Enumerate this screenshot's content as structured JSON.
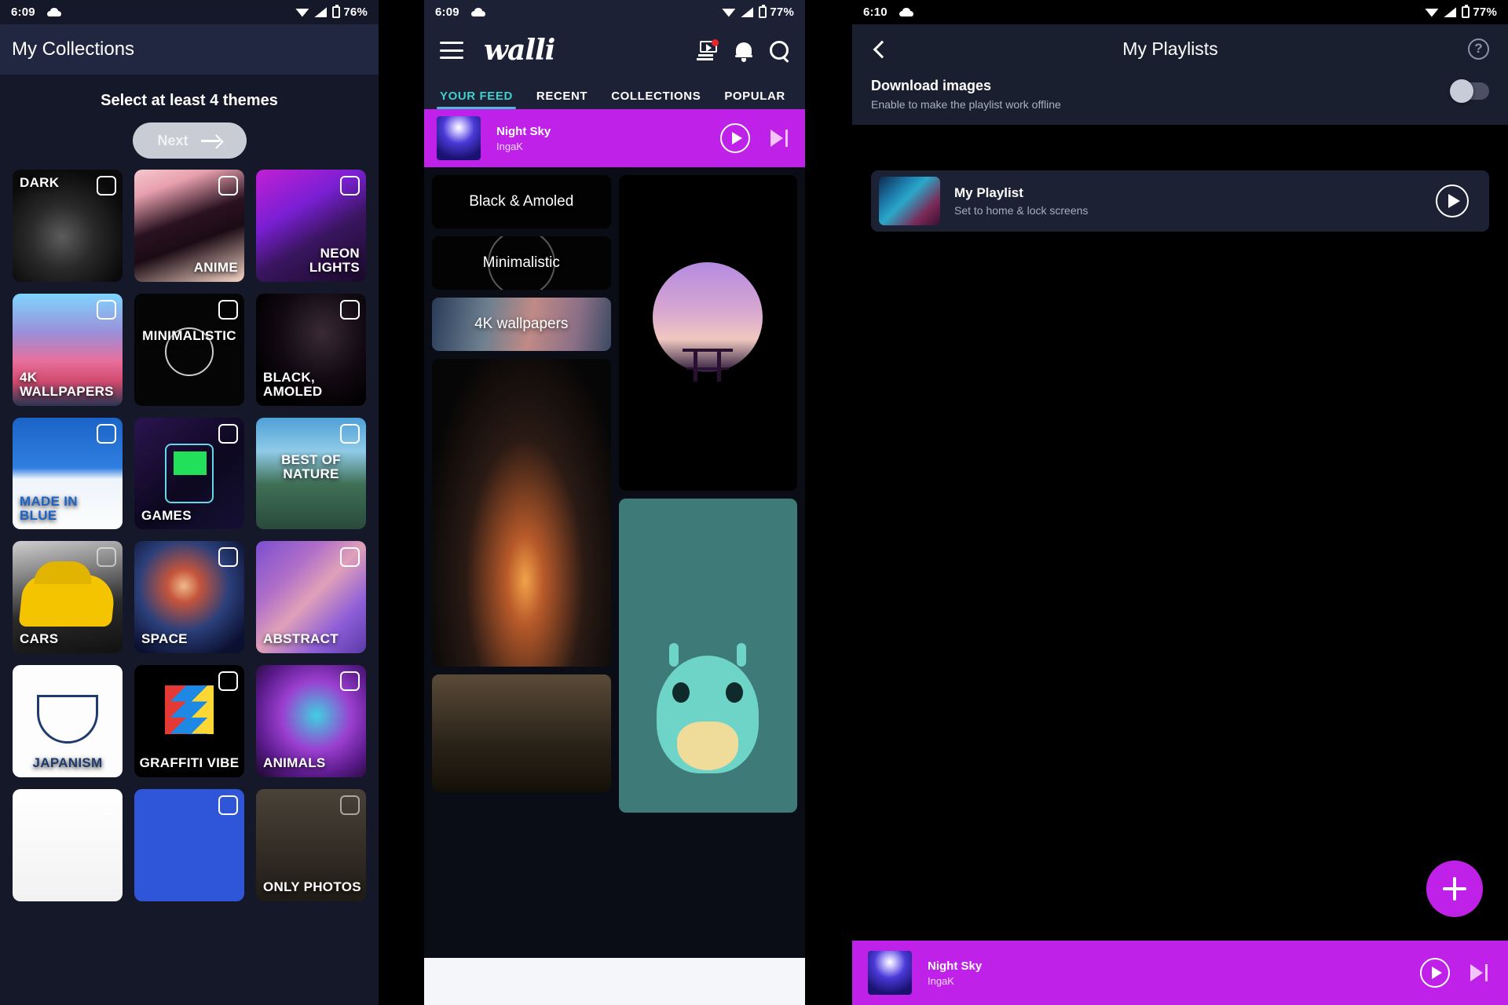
{
  "panel1": {
    "status": {
      "time": "6:09",
      "battery": "76%",
      "icons": [
        "cloud-icon",
        "wifi-icon",
        "signal-icon",
        "battery-icon"
      ]
    },
    "appbar": {
      "title": "My Collections"
    },
    "subtitle": "Select at least 4 themes",
    "next_button": {
      "label": "Next",
      "icon": "arrow-right-icon"
    },
    "tiles": [
      {
        "label": "DARK",
        "pos": "tl",
        "art": "a-dark",
        "checked": false
      },
      {
        "label": "ANIME",
        "pos": "br",
        "art": "a-anime",
        "checked": false
      },
      {
        "label": "NEON\nLIGHTS",
        "pos": "br",
        "art": "a-neon",
        "checked": false
      },
      {
        "label": "4K\nWALLPAPERS",
        "pos": "bl",
        "art": "a-4k",
        "checked": false
      },
      {
        "label": "MINIMALISTIC",
        "pos": "cc",
        "art": "a-min",
        "checked": false
      },
      {
        "label": "BLACK,\nAMOLED",
        "pos": "bl",
        "art": "a-black",
        "checked": false
      },
      {
        "label": "MADE IN\nBLUE",
        "pos": "bl",
        "art": "a-blue",
        "checked": false
      },
      {
        "label": "GAMES",
        "pos": "bl",
        "art": "a-games",
        "checked": false
      },
      {
        "label": "BEST OF NATURE",
        "pos": "cc",
        "art": "a-nature",
        "checked": false
      },
      {
        "label": "CARS",
        "pos": "bl",
        "art": "a-cars",
        "checked": false
      },
      {
        "label": "SPACE",
        "pos": "bl",
        "art": "a-space",
        "checked": false
      },
      {
        "label": "ABSTRACT",
        "pos": "bl",
        "art": "a-abs",
        "checked": false
      },
      {
        "label": "JAPANISM",
        "pos": "bc",
        "art": "a-jap",
        "checked": false
      },
      {
        "label": "GRAFFITI VIBE",
        "pos": "bc",
        "art": "a-graf",
        "checked": false
      },
      {
        "label": "ANIMALS",
        "pos": "bl",
        "art": "a-ani",
        "checked": false
      },
      {
        "label": "",
        "pos": "bl",
        "art": "a-w1",
        "checked": false
      },
      {
        "label": "",
        "pos": "bl",
        "art": "a-w2",
        "checked": false
      },
      {
        "label": "ONLY PHOTOS",
        "pos": "bl",
        "art": "a-w3",
        "checked": false
      }
    ]
  },
  "panel2": {
    "status": {
      "time": "6:09",
      "battery": "77%"
    },
    "brand": "walli",
    "icons": {
      "menu": "hamburger-menu-icon",
      "stack": "video-stack-icon",
      "bell": "notifications-icon",
      "search": "search-icon"
    },
    "tabs": [
      {
        "label": "YOUR FEED",
        "active": true
      },
      {
        "label": "RECENT",
        "active": false
      },
      {
        "label": "COLLECTIONS",
        "active": false
      },
      {
        "label": "POPULAR",
        "active": false
      }
    ],
    "player": {
      "title": "Night Sky",
      "artist": "IngaK",
      "play_icon": "play-circle-icon",
      "next_icon": "skip-next-icon"
    },
    "chips": [
      {
        "label": "Black & Amoled",
        "art": "c-black"
      },
      {
        "label": "Minimalistic",
        "art": "c-min"
      },
      {
        "label": "4K wallpapers",
        "art": "c-4k"
      }
    ],
    "accent": "#3fd0c9",
    "player_color": "#c021e8"
  },
  "panel3": {
    "status": {
      "time": "6:10",
      "battery": "77%"
    },
    "appbar": {
      "title": "My Playlists",
      "back_icon": "back-arrow-icon",
      "help_icon": "help-circle-icon",
      "help_glyph": "?"
    },
    "download": {
      "title": "Download images",
      "subtitle": "Enable to make the playlist work offline",
      "enabled": false
    },
    "playlist": {
      "title": "My Playlist",
      "subtitle": "Set to home & lock screens",
      "play_icon": "play-circle-icon"
    },
    "fab": {
      "icon": "plus-icon"
    },
    "player": {
      "title": "Night Sky",
      "artist": "IngaK",
      "play_icon": "play-circle-icon",
      "next_icon": "skip-next-icon"
    }
  }
}
